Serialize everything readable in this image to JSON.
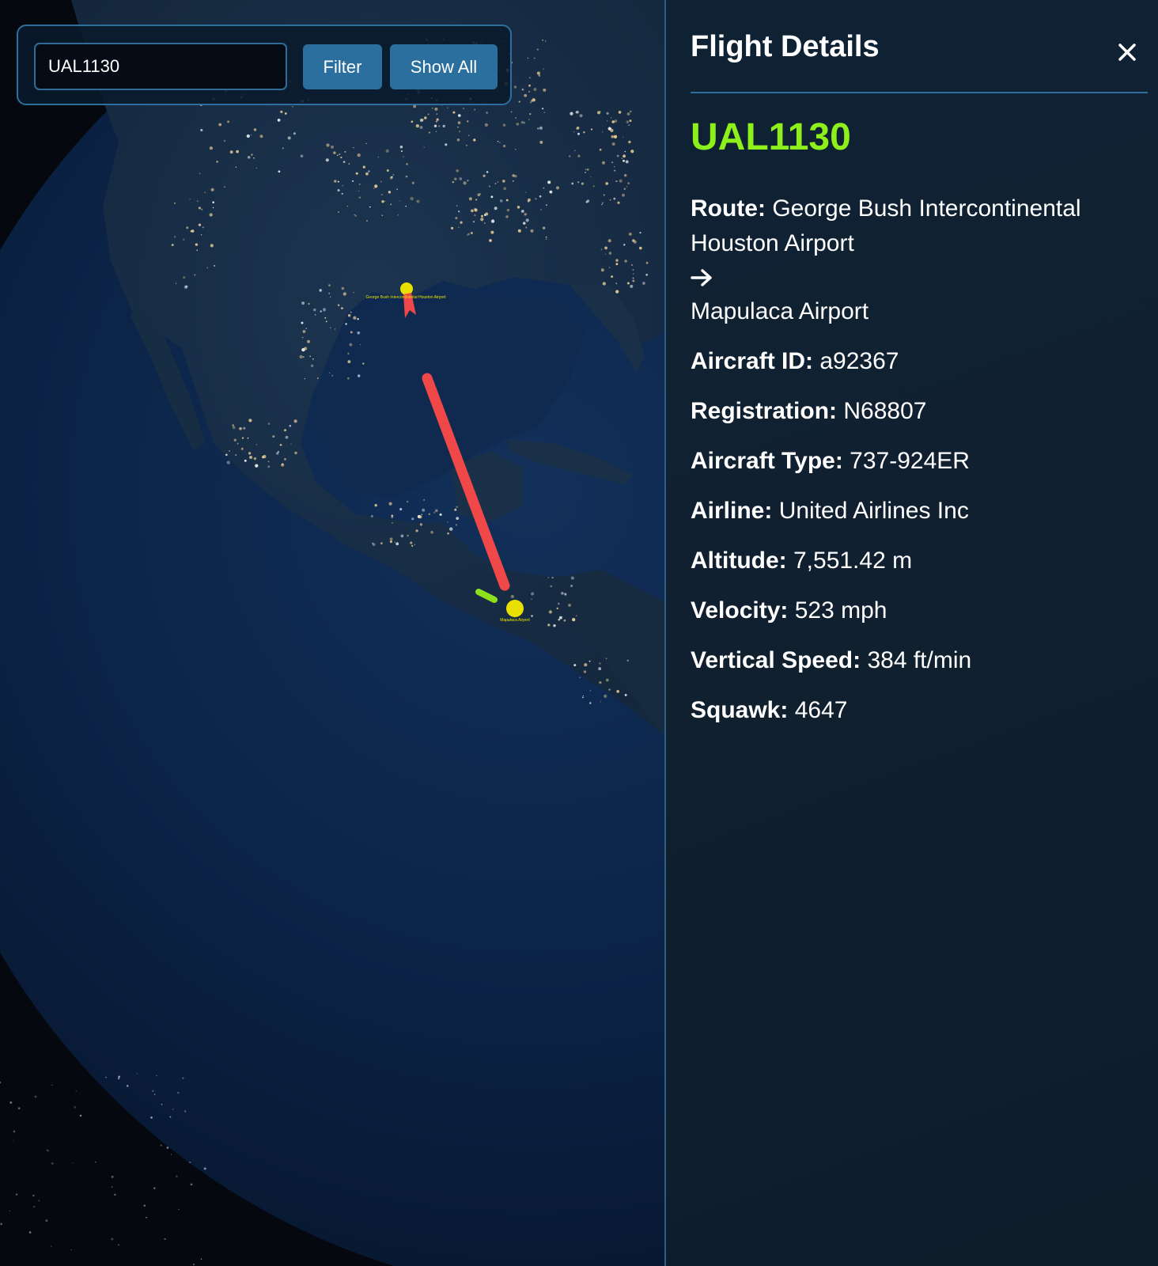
{
  "search": {
    "value": "UAL1130",
    "filter_label": "Filter",
    "show_all_label": "Show All"
  },
  "map": {
    "origin_label": "George Bush Intercontinental Houston Airport",
    "destination_label": "Mapulaca Airport",
    "colors": {
      "flight_path": "#f04848",
      "airport_marker": "#e8e000",
      "aircraft_marker": "#8ee01a"
    }
  },
  "panel": {
    "title": "Flight Details",
    "close_icon": "close-icon",
    "callsign": "UAL1130",
    "callsign_color": "#8ef01a",
    "route": {
      "label": "Route:",
      "origin": "George Bush Intercontinental Houston Airport",
      "destination": "Mapulaca Airport",
      "arrow_icon": "arrow-right-icon"
    },
    "details": {
      "aircraft_id": {
        "label": "Aircraft ID:",
        "value": "a92367"
      },
      "registration": {
        "label": "Registration:",
        "value": "N68807"
      },
      "aircraft_type": {
        "label": "Aircraft Type:",
        "value": "737-924ER"
      },
      "airline": {
        "label": "Airline:",
        "value": "United Airlines Inc"
      },
      "altitude": {
        "label": "Altitude:",
        "value": "7,551.42 m"
      },
      "velocity": {
        "label": "Velocity:",
        "value": "523 mph"
      },
      "vertical_speed": {
        "label": "Vertical Speed:",
        "value": "384 ft/min"
      },
      "squawk": {
        "label": "Squawk:",
        "value": "4647"
      }
    }
  }
}
